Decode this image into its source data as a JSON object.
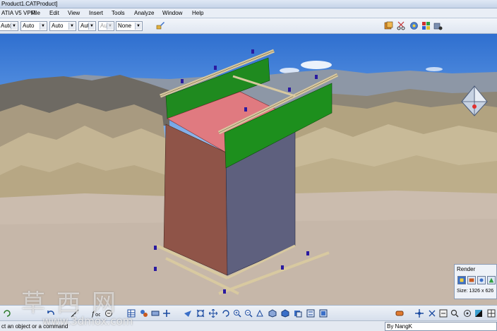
{
  "window": {
    "title": "Product1.CATProduct]"
  },
  "menu": [
    {
      "label": "ATIA V5 VPM"
    },
    {
      "label": "File"
    },
    {
      "label": "Edit"
    },
    {
      "label": "View"
    },
    {
      "label": "Insert"
    },
    {
      "label": "Tools"
    },
    {
      "label": "Analyze"
    },
    {
      "label": "Window"
    },
    {
      "label": "Help"
    }
  ],
  "toolbar": {
    "selects": [
      {
        "value": "Auto",
        "enabled": true
      },
      {
        "value": "Auto",
        "enabled": true
      },
      {
        "value": "Auto",
        "enabled": true
      },
      {
        "value": "Aut",
        "enabled": true
      },
      {
        "value": "Aut",
        "enabled": false
      },
      {
        "value": "None",
        "enabled": true
      }
    ],
    "right_icons": [
      "render-style-icon",
      "scissors-icon",
      "catalog-icon",
      "lighting-icon",
      "environment-icon"
    ]
  },
  "viewport": {
    "background": "desert landscape with blue sky",
    "model": "assembly frame with pink top panel, green side panels and grey front face"
  },
  "render_panel": {
    "title": "Render",
    "size": "Size: 1326 x 626",
    "icons": [
      "render-shot-icon",
      "render-video-icon",
      "render-options-icon",
      "render-quick-icon"
    ]
  },
  "bottom_toolbar": {
    "icons": [
      "update-icon",
      "undo-icon",
      "measure-icon",
      "formula-icon",
      "knowledge-icon",
      "table-icon",
      "assembly-icon",
      "constraint-icon",
      "pan-icon",
      "fly-icon",
      "rotate-icon",
      "zoom-in-icon",
      "zoom-out-icon",
      "normal-view-icon",
      "iso-view-icon",
      "shading-icon",
      "hide-show-icon",
      "swap-icon",
      "layer-icon",
      "render-icon",
      "walk-icon",
      "frame-icon",
      "magnifier-icon",
      "color-icon"
    ]
  },
  "status_bar": {
    "text": "ct an object or a command",
    "command_value": "By NangK"
  },
  "watermark": {
    "chinese": "草西网",
    "url": "www.3dmox.com"
  }
}
